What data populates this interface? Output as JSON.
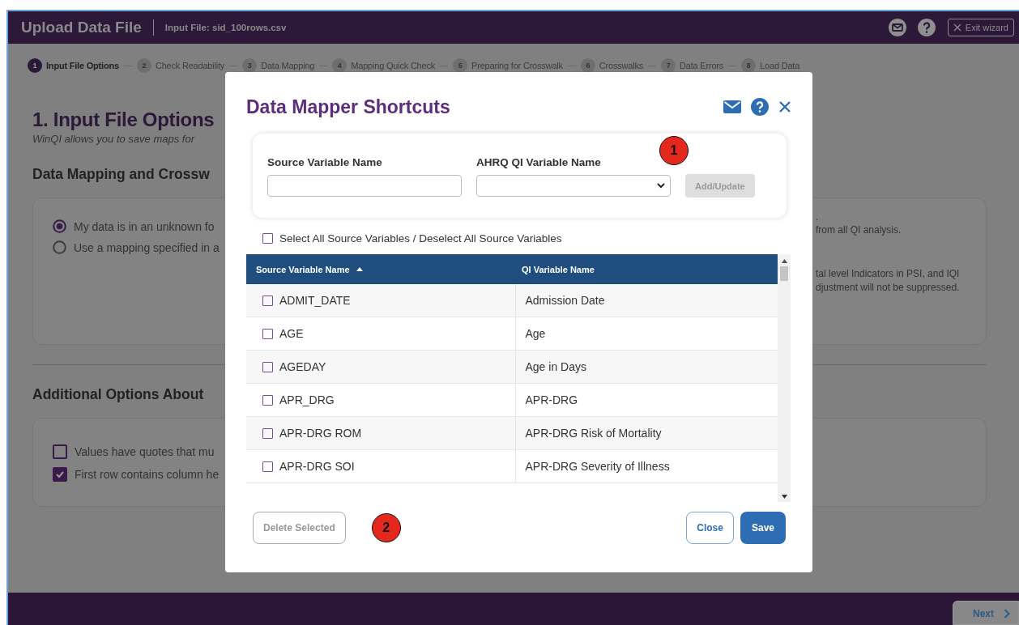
{
  "header": {
    "title": "Upload Data File",
    "file": "Input File: sid_100rows.csv",
    "exit_button": "Exit wizard"
  },
  "steps": [
    {
      "number": "1",
      "label": "Input File Options",
      "selected": true
    },
    {
      "number": "2",
      "label": "Check Readability",
      "selected": false
    },
    {
      "number": "3",
      "label": "Data Mapping",
      "selected": false
    },
    {
      "number": "4",
      "label": "Mapping Quick Check",
      "selected": false
    },
    {
      "number": "5",
      "label": "Preparing for Crosswalk",
      "selected": false
    },
    {
      "number": "6",
      "label": "Crosswalks",
      "selected": false
    },
    {
      "number": "7",
      "label": "Data Errors",
      "selected": false
    },
    {
      "number": "8",
      "label": "Load Data",
      "selected": false
    }
  ],
  "page": {
    "heading": "1. Input File Options",
    "intro": "WinQI allows you to save maps for",
    "section_1": "Data Mapping and Crossw",
    "options": [
      {
        "label": "My data is in an unknown fo",
        "selected": true
      },
      {
        "label": "Use a mapping specified in a",
        "selected": false
      }
    ],
    "notes": [
      ".",
      "from all QI analysis.",
      "tal level Indicators in PSI, and IQI",
      "djustment will not be suppressed."
    ],
    "section_2": "Additional Options About",
    "checkboxes": [
      {
        "label": "Values have quotes that mu",
        "checked": false
      },
      {
        "label": "First row contains column he",
        "checked": true
      }
    ]
  },
  "dialog": {
    "title": "Data Mapper Shortcuts",
    "form": {
      "source_label": "Source Variable Name",
      "target_label": "AHRQ QI Variable Name",
      "add_button": {
        "label": "Add/Update",
        "disabled": true
      }
    },
    "select_all": {
      "label": "Select All Source Variables / Deselect All Source Variables",
      "checked": false
    },
    "table": {
      "columns": [
        {
          "label": "Source Variable Name",
          "sorted": true
        },
        {
          "label": "QI Variable Name"
        }
      ],
      "rows": [
        {
          "source": "ADMIT_DATE",
          "target": "Admission Date",
          "checked": false
        },
        {
          "source": "AGE",
          "target": "Age",
          "checked": false
        },
        {
          "source": "AGEDAY",
          "target": "Age in Days",
          "checked": false
        },
        {
          "source": "APR_DRG",
          "target": "APR-DRG",
          "checked": false
        },
        {
          "source": "APR-DRG ROM",
          "target": "APR-DRG Risk of Mortality",
          "checked": false
        },
        {
          "source": "APR-DRG SOI",
          "target": "APR-DRG Severity of Illness",
          "checked": false
        }
      ]
    },
    "delete_button": {
      "label": "Delete Selected",
      "disabled": true
    },
    "close_button": "Close",
    "save_button": "Save",
    "callouts": [
      "1",
      "2"
    ]
  },
  "footer": {
    "next_button": "Next"
  }
}
